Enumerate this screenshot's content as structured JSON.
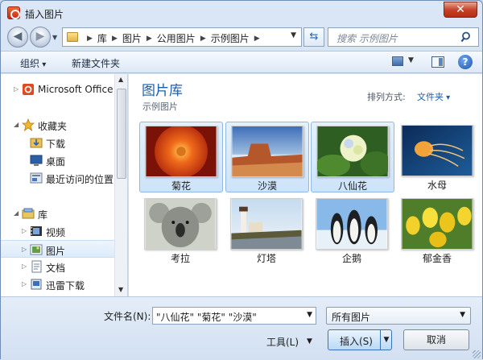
{
  "window": {
    "title": "插入图片"
  },
  "address": {
    "crumbs": [
      "库",
      "图片",
      "公用图片",
      "示例图片"
    ]
  },
  "search": {
    "placeholder": "搜索 示例图片"
  },
  "toolbar": {
    "organize": "组织",
    "new_folder": "新建文件夹"
  },
  "nav": {
    "items": [
      {
        "label": "Microsoft Office",
        "icon": "office-icon"
      },
      {
        "label": "收藏夹",
        "icon": "star-icon"
      },
      {
        "label": "下载",
        "icon": "download-folder-icon"
      },
      {
        "label": "桌面",
        "icon": "desktop-icon"
      },
      {
        "label": "最近访问的位置",
        "icon": "recent-places-icon"
      },
      {
        "label": "库",
        "icon": "library-icon"
      },
      {
        "label": "视频",
        "icon": "video-icon"
      },
      {
        "label": "图片",
        "icon": "pictures-icon"
      },
      {
        "label": "文档",
        "icon": "documents-icon"
      },
      {
        "label": "迅雷下载",
        "icon": "thunder-download-icon"
      }
    ]
  },
  "library": {
    "title": "图片库",
    "subtitle": "示例图片",
    "arrange_label": "排列方式:",
    "arrange_value": "文件夹"
  },
  "thumbnails": [
    {
      "caption": "菊花",
      "selected": true
    },
    {
      "caption": "沙漠",
      "selected": true
    },
    {
      "caption": "八仙花",
      "selected": true
    },
    {
      "caption": "水母",
      "selected": false
    },
    {
      "caption": "考拉",
      "selected": false
    },
    {
      "caption": "灯塔",
      "selected": false
    },
    {
      "caption": "企鹅",
      "selected": false
    },
    {
      "caption": "郁金香",
      "selected": false
    }
  ],
  "bottom": {
    "filename_label": "文件名(N):",
    "filename_value": "\"八仙花\" \"菊花\" \"沙漠\"",
    "filter_value": "所有图片",
    "tools_label": "工具(L)",
    "insert_label": "插入(S)",
    "cancel_label": "取消"
  },
  "colors": {
    "accent": "#1e5ea8",
    "selection": "#cde3fa"
  }
}
